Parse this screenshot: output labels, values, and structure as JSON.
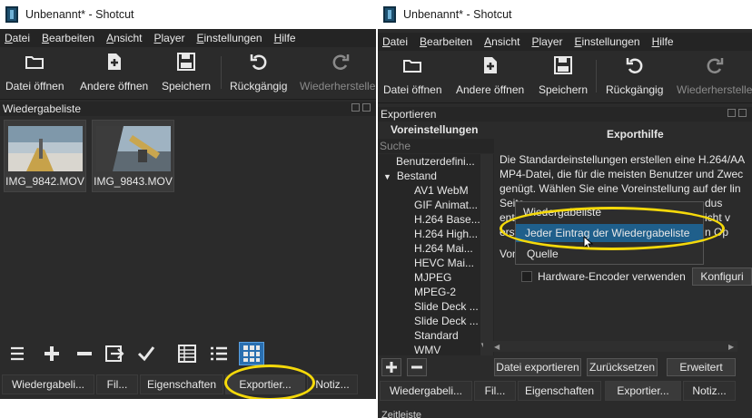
{
  "left_window": {
    "title": "Unbenannt* - Shotcut",
    "menu": [
      "Datei",
      "Bearbeiten",
      "Ansicht",
      "Player",
      "Einstellungen",
      "Hilfe"
    ],
    "toolbar": {
      "open": "Datei öffnen",
      "open_other": "Andere öffnen",
      "save": "Speichern",
      "undo": "Rückgängig",
      "redo": "Wiederherstellen"
    },
    "playlist_title": "Wiedergabeliste",
    "clips": [
      "IMG_9842.MOV",
      "IMG_9843.MOV"
    ],
    "tabs": [
      "Wiedergabeli...",
      "Fil...",
      "Eigenschaften",
      "Exportier...",
      "Notiz..."
    ]
  },
  "right_window": {
    "title": "Unbenannt* - Shotcut",
    "menu": [
      "Datei",
      "Bearbeiten",
      "Ansicht",
      "Player",
      "Einstellungen",
      "Hilfe"
    ],
    "toolbar": {
      "open": "Datei öffnen",
      "open_other": "Andere öffnen",
      "save": "Speichern",
      "undo": "Rückgängig",
      "redo": "Wiederherstelle"
    },
    "export_title": "Exportieren",
    "presets_header": "Voreinstellungen",
    "search_placeholder": "Suche",
    "tree_items": [
      {
        "label": "Benutzerdefini...",
        "level": 0
      },
      {
        "label": "Bestand",
        "level": 0,
        "expanded": true
      },
      {
        "label": "AV1 WebM",
        "level": 1
      },
      {
        "label": "GIF Animat...",
        "level": 1
      },
      {
        "label": "H.264 Base...",
        "level": 1
      },
      {
        "label": "H.264 High...",
        "level": 1
      },
      {
        "label": "H.264 Mai...",
        "level": 1
      },
      {
        "label": "HEVC Mai...",
        "level": 1
      },
      {
        "label": "MJPEG",
        "level": 1
      },
      {
        "label": "MPEG-2",
        "level": 1
      },
      {
        "label": "Slide Deck ...",
        "level": 1
      },
      {
        "label": "Slide Deck ...",
        "level": 1
      },
      {
        "label": "Standard",
        "level": 1
      },
      {
        "label": "WMV",
        "level": 1
      }
    ],
    "help_title": "Exporthilfe",
    "help_lines": [
      "Die Standardeinstellungen erstellen eine H.264/AA",
      "MP4-Datei, die für die meisten Benutzer und Zwec",
      "genügt. Wählen Sie eine Voreinstellung auf der lin",
      "Seite",
      "ents",
      "erste"
    ],
    "help_right_fragments": [
      "dus",
      "icht v",
      "n Op"
    ],
    "from_label": "Von",
    "popup_items": [
      "Wiedergabeliste",
      "Jeder Eintrag der Wiedergabeliste",
      "Quelle"
    ],
    "hw_encoder_label": "Hardware-Encoder verwenden",
    "configure_label": "Konfiguri",
    "buttons": {
      "export": "Datei exportieren",
      "reset": "Zurücksetzen",
      "advanced": "Erweitert"
    },
    "tabs": [
      "Wiedergabeli...",
      "Fil...",
      "Eigenschaften",
      "Exportier...",
      "Notiz..."
    ],
    "timeline_label": "Zeitleiste"
  },
  "colors": {
    "highlight_ellipse": "#f5d90a",
    "selection": "#1f5f8b",
    "active_grid_button": "#2a6fb0"
  }
}
